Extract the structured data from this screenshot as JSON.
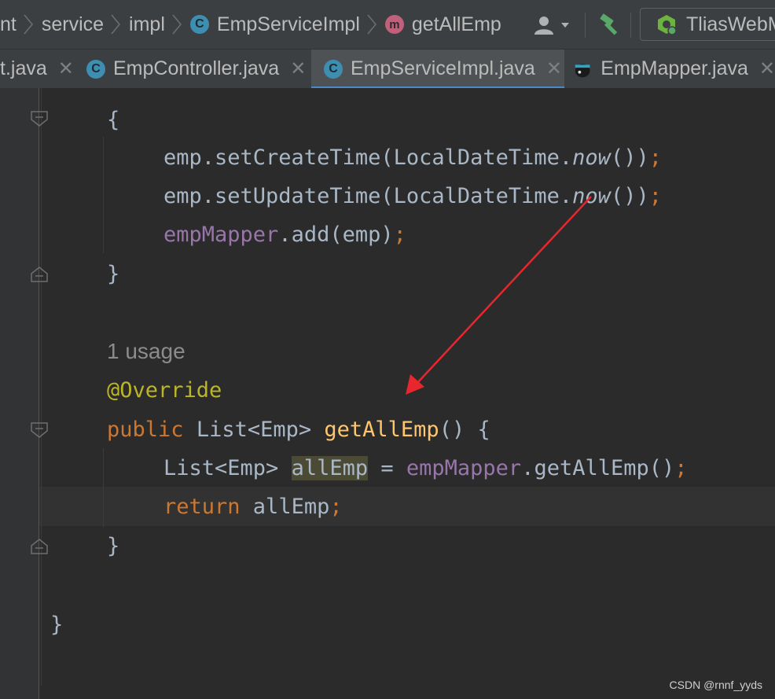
{
  "breadcrumbs": [
    "nt",
    "service",
    "impl",
    "EmpServiceImpl",
    "getAllEmp"
  ],
  "breadcrumb_icons": {
    "class": "C",
    "method": "m"
  },
  "run_config": "TliasWebM",
  "tabs": [
    {
      "label": "t.java"
    },
    {
      "label": "EmpController.java"
    },
    {
      "label": "EmpServiceImpl.java"
    },
    {
      "label": "EmpMapper.java"
    }
  ],
  "code": {
    "open_brace": "{",
    "l1_recv": "emp.setCreateTime(LocalDateTime.",
    "l1_now": "now",
    "l1_tail": "())",
    "l2_recv": "emp.setUpdateTime(LocalDateTime.",
    "l2_now": "now",
    "l2_tail": "())",
    "l3_field": "empMapper",
    "l3_tail": ".add(emp)",
    "close_brace": "}",
    "usage": "1 usage",
    "annotation": "@Override",
    "kw_public": "public",
    "ret_type": "List<Emp> ",
    "method_name": "getAllEmp",
    "sig_tail": "() {",
    "l5_type": "List<Emp> ",
    "l5_var": "allEmp",
    "l5_eq": " = ",
    "l5_field": "empMapper",
    "l5_tail": ".getAllEmp()",
    "kw_return": "return",
    "l6_tail": " allEmp",
    "semicolon": ";",
    "inner_close": "}",
    "class_close": "}"
  },
  "watermark": "CSDN @rnnf_yyds",
  "colors": {
    "keyword": "#cc7832",
    "field": "#9876aa",
    "method": "#ffc66d",
    "annotation": "#bbb529",
    "arrow": "#e8262d"
  }
}
